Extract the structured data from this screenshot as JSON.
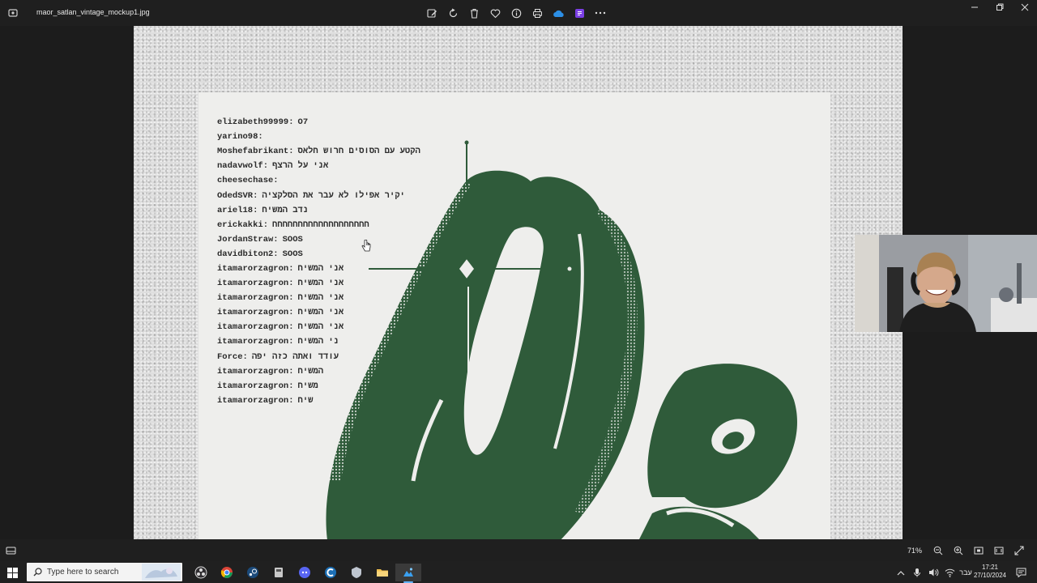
{
  "window": {
    "filename": "maor_satlan_vintage_mockup1.jpg"
  },
  "toolbar": {
    "items": [
      {
        "name": "edit-icon"
      },
      {
        "name": "rotate-icon"
      },
      {
        "name": "delete-icon"
      },
      {
        "name": "favorite-heart-icon"
      },
      {
        "name": "info-icon"
      },
      {
        "name": "print-icon"
      },
      {
        "name": "onedrive-cloud-icon"
      },
      {
        "name": "clipchamp-icon"
      },
      {
        "name": "more-options-icon"
      }
    ],
    "colors": {
      "onedrive": "#2c8fe6",
      "clipchamp": "#7b3fe4"
    }
  },
  "chat": [
    {
      "user": "elizabeth99999:",
      "msg": "O7"
    },
    {
      "user": "yarino98:",
      "msg": ""
    },
    {
      "user": "Moshefabrikant:",
      "msg": "הקטע עם הסוסים חרוש חלאס"
    },
    {
      "user": "nadavwolf:",
      "msg": "אני על הרצף"
    },
    {
      "user": "cheesechase:",
      "msg": ""
    },
    {
      "user": "OdedSVR:",
      "msg": "יקיר אפילו לא עבר את הסלקציה"
    },
    {
      "user": "ariel18:",
      "msg": "נדב המשיח"
    },
    {
      "user": "erickakki:",
      "msg": "חחחחחחחחחחחחחחחחחחח"
    },
    {
      "user": "JordanStraw:",
      "msg": "SOOS"
    },
    {
      "user": "davidbiton2:",
      "msg": "SOOS"
    },
    {
      "user": "itamarorzagron:",
      "msg": "אני המשיח"
    },
    {
      "user": "itamarorzagron:",
      "msg": "אני המשיח"
    },
    {
      "user": "itamarorzagron:",
      "msg": "אני המשיח"
    },
    {
      "user": "itamarorzagron:",
      "msg": "אני המשיח"
    },
    {
      "user": "itamarorzagron:",
      "msg": "אני המשיח"
    },
    {
      "user": "itamarorzagron:",
      "msg": "ני המשיח"
    },
    {
      "user": "Force:",
      "msg": "עודד ואתה כזה יפה"
    },
    {
      "user": "itamarorzagron:",
      "msg": "המשיח"
    },
    {
      "user": "itamarorzagron:",
      "msg": "משיח"
    },
    {
      "user": "itamarorzagron:",
      "msg": "שיח"
    }
  ],
  "poster": {
    "ink_color": "#2f5b3a",
    "paper_color": "#eeeeec"
  },
  "status": {
    "zoom": "71%"
  },
  "taskbar": {
    "search_placeholder": "Type here to search",
    "apps": [
      "obs-icon",
      "chrome-icon",
      "steam-icon",
      "app-icon",
      "discord-icon",
      "ccleaner-icon",
      "app-icon-2",
      "file-explorer-icon",
      "photos-app-icon"
    ],
    "language": "עבר",
    "time": "17:21",
    "date": "27/10/2024",
    "accent": "#60b3ff"
  }
}
